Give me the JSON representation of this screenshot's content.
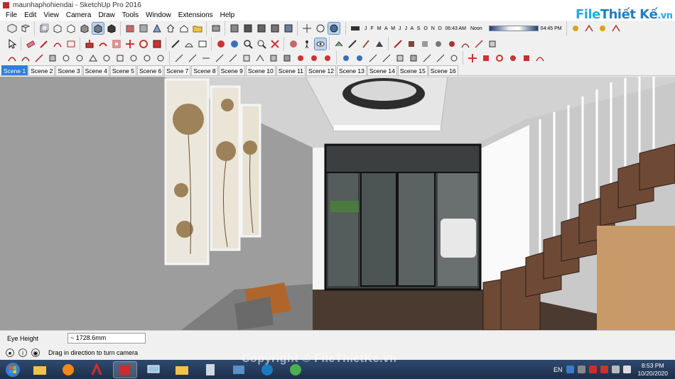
{
  "window": {
    "title": "maunhaphohiendai - SketchUp Pro 2016"
  },
  "menu": [
    "File",
    "Edit",
    "View",
    "Camera",
    "Draw",
    "Tools",
    "Window",
    "Extensions",
    "Help"
  ],
  "shadow": {
    "months": "J F M A M J J A S O N D",
    "time_start": "06:43 AM",
    "time_mid": "Noon",
    "time_end": "04:45 PM"
  },
  "scenes": [
    "Scene 1",
    "Scene 2",
    "Scene 3",
    "Scene 4",
    "Scene 5",
    "Scene 6",
    "Scene 7",
    "Scene 8",
    "Scene 9",
    "Scene 10",
    "Scene 11",
    "Scene 12",
    "Scene 13",
    "Scene 14",
    "Scene 15",
    "Scene 16"
  ],
  "active_scene": "Scene 1",
  "measurements": {
    "label": "Eye Height",
    "value": "~ 1728.6mm"
  },
  "status": {
    "hint": "Drag in direction to turn camera"
  },
  "tray": {
    "language": "EN",
    "time": "8:53 PM",
    "date": "10/20/2020"
  },
  "watermark": {
    "logo_main": "File",
    "logo_accent": "Thiết Kế",
    "logo_suffix": ".vn",
    "copyright": "Copyright © FileThietKe.vn"
  },
  "colors": {
    "accent": "#2f7fd6",
    "wood": "#8a5a3c",
    "taskbar": "#1c2f4a"
  }
}
